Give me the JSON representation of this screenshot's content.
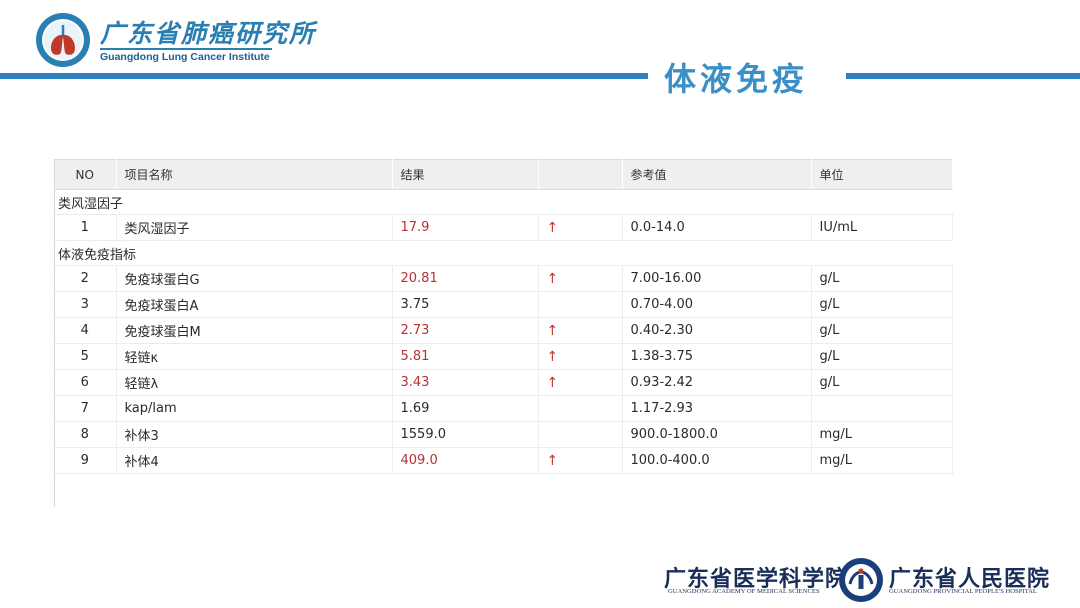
{
  "header": {
    "institute_cn": "广东省肺癌研究所",
    "institute_en": "Guangdong Lung Cancer Institute",
    "title": "体液免疫"
  },
  "table": {
    "columns": [
      "NO",
      "项目名称",
      "结果",
      "",
      "参考值",
      "单位"
    ],
    "groups": [
      {
        "name": "类风湿因子",
        "rows": [
          {
            "no": "1",
            "item": "类风湿因子",
            "result": "17.9",
            "flag": "↑",
            "ref": "0.0-14.0",
            "unit": "IU/mL",
            "abnormal": true
          }
        ]
      },
      {
        "name": "体液免疫指标",
        "rows": [
          {
            "no": "2",
            "item": "免疫球蛋白G",
            "result": "20.81",
            "flag": "↑",
            "ref": "7.00-16.00",
            "unit": "g/L",
            "abnormal": true
          },
          {
            "no": "3",
            "item": "免疫球蛋白A",
            "result": "3.75",
            "flag": "",
            "ref": "0.70-4.00",
            "unit": "g/L",
            "abnormal": false
          },
          {
            "no": "4",
            "item": "免疫球蛋白M",
            "result": "2.73",
            "flag": "↑",
            "ref": "0.40-2.30",
            "unit": "g/L",
            "abnormal": true
          },
          {
            "no": "5",
            "item": "轻链κ",
            "result": "5.81",
            "flag": "↑",
            "ref": "1.38-3.75",
            "unit": "g/L",
            "abnormal": true
          },
          {
            "no": "6",
            "item": "轻链λ",
            "result": "3.43",
            "flag": "↑",
            "ref": "0.93-2.42",
            "unit": "g/L",
            "abnormal": true
          },
          {
            "no": "7",
            "item": "kap/lam",
            "result": "1.69",
            "flag": "",
            "ref": "1.17-2.93",
            "unit": "",
            "abnormal": false
          },
          {
            "no": "8",
            "item": "补体3",
            "result": "1559.0",
            "flag": "",
            "ref": "900.0-1800.0",
            "unit": "mg/L",
            "abnormal": false
          },
          {
            "no": "9",
            "item": "补体4",
            "result": "409.0",
            "flag": "↑",
            "ref": "100.0-400.0",
            "unit": "mg/L",
            "abnormal": true
          }
        ]
      }
    ]
  },
  "footer": {
    "academy_cn": "广东省医学科学院",
    "academy_en": "GUANGDONG ACADEMY OF MEDICAL SCIENCES",
    "hospital_cn": "广东省人民医院",
    "hospital_en": "GUANGDONG PROVINCIAL PEOPLE'S HOSPITAL"
  },
  "colors": {
    "accent_blue": "#2b82bf",
    "abnormal_red": "#b83232"
  }
}
